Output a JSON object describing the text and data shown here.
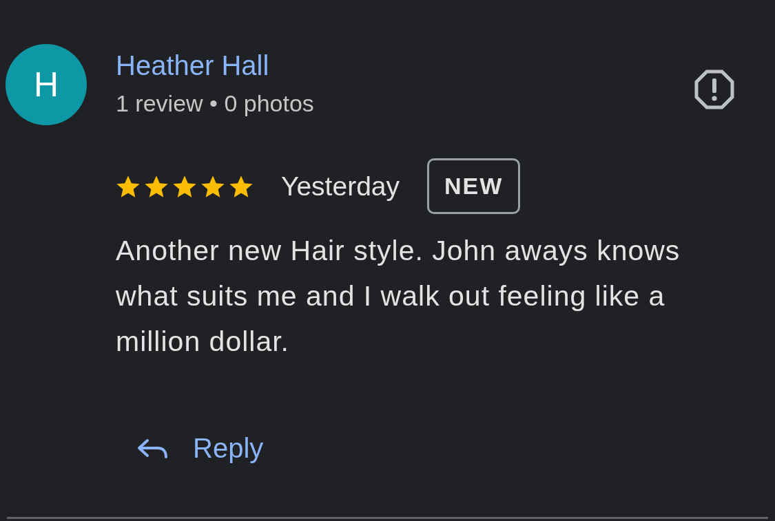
{
  "review": {
    "avatar": {
      "letter": "H",
      "color": "#0e98a6"
    },
    "author": "Heather Hall",
    "meta": "1 review • 0 photos",
    "stars": 5,
    "date": "Yesterday",
    "badge": "NEW",
    "text": "Another new Hair style. John aways knows what suits me and I walk out feeling like a million dollar.",
    "reply": "Reply"
  }
}
